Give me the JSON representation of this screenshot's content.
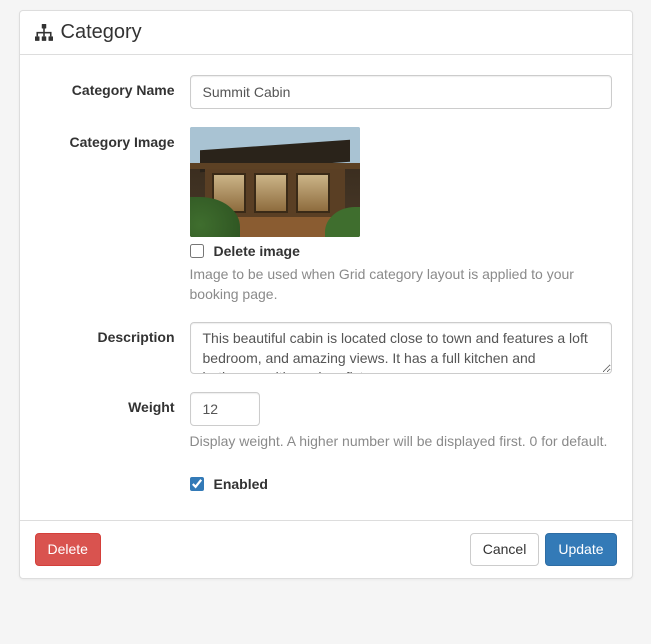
{
  "header": {
    "title": "Category",
    "icon": "sitemap-icon"
  },
  "form": {
    "name": {
      "label": "Category Name",
      "value": "Summit Cabin"
    },
    "image": {
      "label": "Category Image",
      "delete_checkbox_label": "Delete image",
      "delete_checked": false,
      "help": "Image to be used when Grid category layout is applied to your booking page."
    },
    "description": {
      "label": "Description",
      "value": "This beautiful cabin is located close to town and features a loft bedroom, and amazing views. It has a full kitchen and bathroom with modern fixtures."
    },
    "weight": {
      "label": "Weight",
      "value": "12",
      "help": "Display weight. A higher number will be displayed first. 0 for default."
    },
    "enabled": {
      "label": "Enabled",
      "checked": true
    }
  },
  "footer": {
    "delete_label": "Delete",
    "cancel_label": "Cancel",
    "update_label": "Update"
  }
}
